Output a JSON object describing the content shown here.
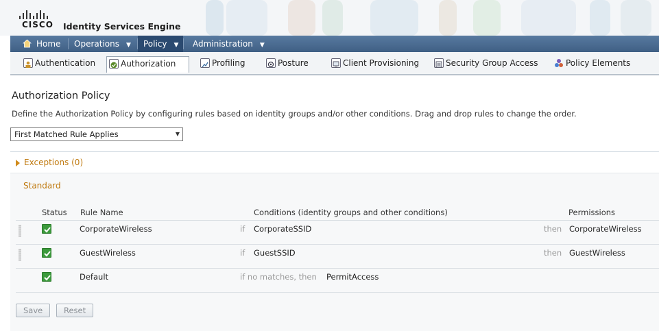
{
  "brand": {
    "logo_text": "CISCO",
    "app_title": "Identity Services Engine"
  },
  "nav": {
    "items": [
      {
        "label": "Home",
        "icon": "home-icon"
      },
      {
        "label": "Operations"
      },
      {
        "label": "Policy",
        "active": true
      },
      {
        "label": "Administration"
      }
    ]
  },
  "subnav": {
    "items": [
      {
        "label": "Authentication",
        "icon": "authentication-icon"
      },
      {
        "label": "Authorization",
        "icon": "authorization-icon",
        "active": true
      },
      {
        "label": "Profiling",
        "icon": "profiling-icon"
      },
      {
        "label": "Posture",
        "icon": "posture-icon"
      },
      {
        "label": "Client Provisioning",
        "icon": "client-provisioning-icon"
      },
      {
        "label": "Security Group Access",
        "icon": "security-group-access-icon"
      },
      {
        "label": "Policy Elements",
        "icon": "policy-elements-icon"
      }
    ]
  },
  "page": {
    "title": "Authorization Policy",
    "description": "Define the Authorization Policy by configuring rules based on identity groups and/or other conditions. Drag and drop rules to change the order.",
    "match_mode": "First Matched Rule Applies"
  },
  "exceptions": {
    "label": "Exceptions (0)"
  },
  "standard": {
    "label": "Standard"
  },
  "table": {
    "headers": {
      "status": "Status",
      "rule_name": "Rule Name",
      "conditions": "Conditions (identity groups and other conditions)",
      "permissions": "Permissions"
    },
    "rows": [
      {
        "name": "CorporateWireless",
        "if": "if",
        "condition": "CorporateSSID",
        "then": "then",
        "permission": "CorporateWireless"
      },
      {
        "name": "GuestWireless",
        "if": "if",
        "condition": "GuestSSID",
        "then": "then",
        "permission": "GuestWireless"
      }
    ],
    "default_row": {
      "name": "Default",
      "if_text": "if no matches, then",
      "permission": "PermitAccess"
    }
  },
  "buttons": {
    "save": "Save",
    "reset": "Reset"
  },
  "colors": {
    "nav_bg": "#4a6a8f",
    "accent_orange": "#c07a10",
    "check_green": "#3c9a3c"
  }
}
